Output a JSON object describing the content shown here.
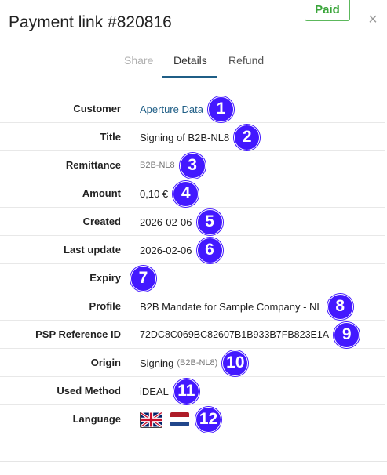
{
  "header": {
    "title": "Payment link #820816",
    "status_badge": "Paid",
    "close_symbol": "×"
  },
  "tabs": [
    {
      "label": "Share"
    },
    {
      "label": "Details"
    },
    {
      "label": "Refund"
    }
  ],
  "details": {
    "customer": {
      "label": "Customer",
      "value": "Aperture Data",
      "marker": "1"
    },
    "title": {
      "label": "Title",
      "value": "Signing of B2B-NL8",
      "marker": "2"
    },
    "remittance": {
      "label": "Remittance",
      "value": "B2B-NL8",
      "marker": "3"
    },
    "amount": {
      "label": "Amount",
      "value": "0,10 €",
      "marker": "4"
    },
    "created": {
      "label": "Created",
      "value": "2026-02-06",
      "marker": "5"
    },
    "last_update": {
      "label": "Last update",
      "value": "2026-02-06",
      "marker": "6"
    },
    "expiry": {
      "label": "Expiry",
      "value": "",
      "marker": "7"
    },
    "profile": {
      "label": "Profile",
      "value": "B2B Mandate for Sample Company - NL",
      "marker": "8"
    },
    "psp_reference": {
      "label": "PSP Reference ID",
      "value": "72DC8C069BC82607B1B933B7FB823E1A",
      "marker": "9"
    },
    "origin": {
      "label": "Origin",
      "value": "Signing",
      "sub": "(B2B-NL8)",
      "marker": "10"
    },
    "used_method": {
      "label": "Used Method",
      "value": "iDEAL",
      "marker": "11"
    },
    "language": {
      "label": "Language",
      "flags": [
        "uk-flag-icon",
        "netherlands-flag-icon"
      ],
      "marker": "12"
    }
  },
  "colors": {
    "marker_bg": "#4318ff",
    "paid_green": "#3aa53a",
    "link_blue": "#1f5e86"
  }
}
